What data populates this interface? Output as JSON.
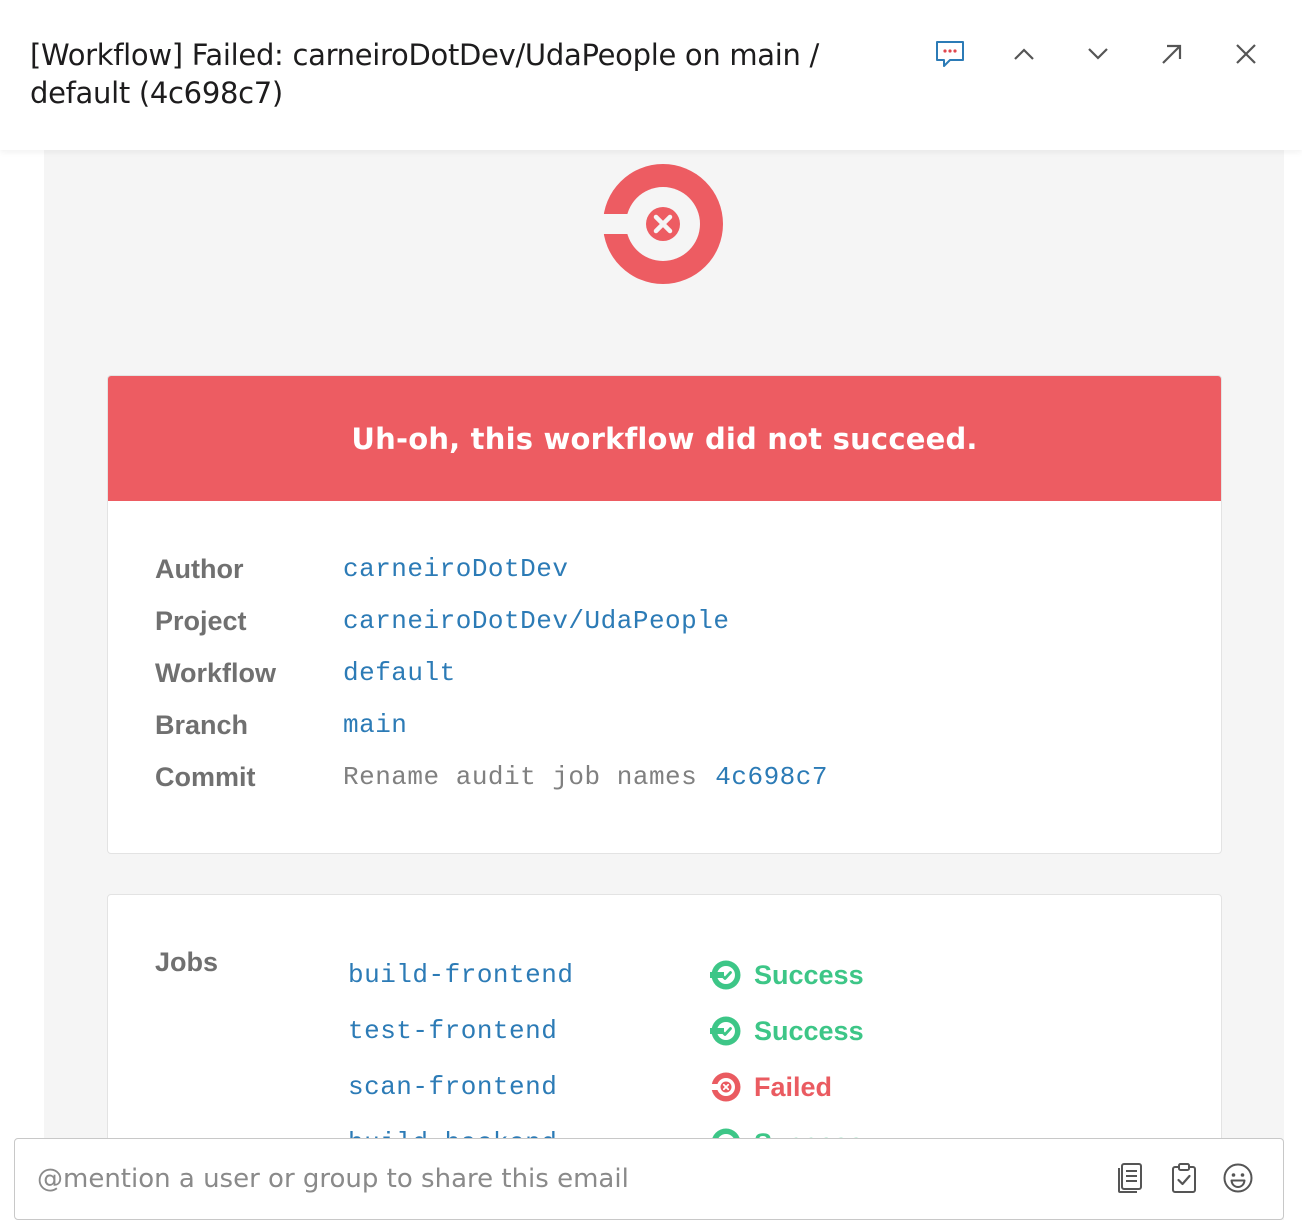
{
  "header": {
    "subject": "[Workflow] Failed: carneiroDotDev/UdaPeople on main / default (4c698c7)",
    "icons": [
      "comment-icon",
      "chevron-up-icon",
      "chevron-down-icon",
      "open-external-icon",
      "close-icon"
    ]
  },
  "colors": {
    "brand_red": "#ed5c62",
    "link_blue": "#2c7bb6",
    "success_green": "#3dc687",
    "failed_red": "#ea5b61"
  },
  "email": {
    "banner": "Uh-oh, this workflow did not succeed.",
    "details": [
      {
        "label": "Author",
        "value": "carneiroDotDev"
      },
      {
        "label": "Project",
        "value": "carneiroDotDev/UdaPeople"
      },
      {
        "label": "Workflow",
        "value": "default"
      },
      {
        "label": "Branch",
        "value": "main"
      },
      {
        "label": "Commit",
        "message": "Rename audit job names",
        "value": "4c698c7"
      }
    ],
    "jobs_label": "Jobs",
    "jobs": [
      {
        "name": "build-frontend",
        "status": "Success"
      },
      {
        "name": "test-frontend",
        "status": "Success"
      },
      {
        "name": "scan-frontend",
        "status": "Failed"
      },
      {
        "name": "build-backend",
        "status": "Success"
      }
    ]
  },
  "share": {
    "placeholder": "@mention a user or group to share this email",
    "icons": [
      "notes-icon",
      "task-clipboard-icon",
      "emoji-icon"
    ]
  }
}
